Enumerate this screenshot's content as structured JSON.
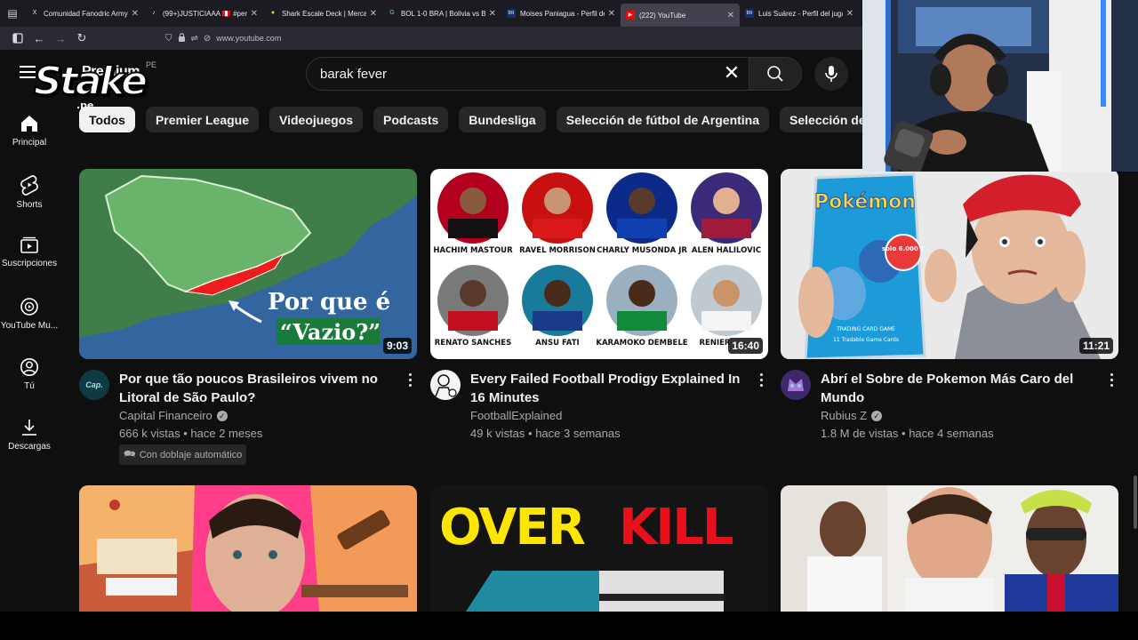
{
  "browser": {
    "tabs": [
      {
        "title": "Comunidad Fanodric Army",
        "favicon": "X"
      },
      {
        "title": "(99+)JUSTICIAAA 🇵🇪 #peru",
        "favicon": "♪"
      },
      {
        "title": "Shark Escale Deck | Mercad",
        "favicon": "●"
      },
      {
        "title": "BOL 1-0 BRA | Bolivia vs Br",
        "favicon": "G"
      },
      {
        "title": "Moises Paniagua - Perfil de",
        "favicon": "tm"
      },
      {
        "title": "(222) YouTube",
        "favicon": "▶"
      },
      {
        "title": "Luis Suárez - Perfil del juga",
        "favicon": "tm"
      }
    ],
    "active_tab": 5,
    "url": "www.youtube.com"
  },
  "youtube": {
    "logo": "Premium",
    "region": "PE",
    "overlay_brand": "Stake",
    "overlay_brand_suffix": ".pe",
    "search_value": "barak fever"
  },
  "chips": [
    "Todos",
    "Premier League",
    "Videojuegos",
    "Podcasts",
    "Bundesliga",
    "Selección de fútbol de Argentina",
    "Selección de fútbol de Perú"
  ],
  "leftnav": [
    {
      "label": "Principal",
      "icon": "home-icon"
    },
    {
      "label": "Shorts",
      "icon": "shorts-icon"
    },
    {
      "label": "Suscripciones",
      "icon": "subscriptions-icon"
    },
    {
      "label": "YouTube Mu...",
      "icon": "youtube-music-icon"
    },
    {
      "label": "Tú",
      "icon": "you-icon"
    },
    {
      "label": "Descargas",
      "icon": "download-icon"
    }
  ],
  "videos": [
    {
      "title": "Por que tão poucos Brasileiros vivem no Litoral de São Paulo?",
      "channel": "Capital Financeiro",
      "verified": true,
      "stats": "666 k vistas • hace 2 meses",
      "duration": "9:03",
      "badge": "Con doblaje automático",
      "avatar_text": "Cap.",
      "thumb_text_1": "Por que é",
      "thumb_text_2": "“Vazio?”"
    },
    {
      "title": "Every Failed Football Prodigy Explained In 16 Minutes",
      "channel": "FootballExplained",
      "verified": false,
      "stats": "49 k vistas • hace 3 semanas",
      "duration": "16:40",
      "players": [
        "HACHIM MASTOUR",
        "RAVEL MORRISON",
        "CHARLY MUSONDA JR",
        "ALEN HALILOVIC",
        "RENATO SANCHES",
        "ANSU FATI",
        "KARAMOKO DEMBELE",
        "RENIER"
      ]
    },
    {
      "title": "Abrí el Sobre de Pokemon Más Caro del Mundo",
      "channel": "Rubius Z",
      "verified": true,
      "stats": "1.8 M de vistas • hace 4 semanas",
      "duration": "11:21",
      "thumb_pack": "Pokémon",
      "thumb_price": "solo 6.000 €",
      "thumb_card": "TRADING CARD GAME",
      "thumb_pack_sub": "11 Tradable Game Cards"
    }
  ],
  "row2": {
    "overkill_1": "OVER",
    "overkill_2": "KILL"
  },
  "colors": {
    "background": "#0f0f0f",
    "chip": "#272727",
    "overkill_yellow": "#ffe600",
    "overkill_red": "#e8101a"
  }
}
